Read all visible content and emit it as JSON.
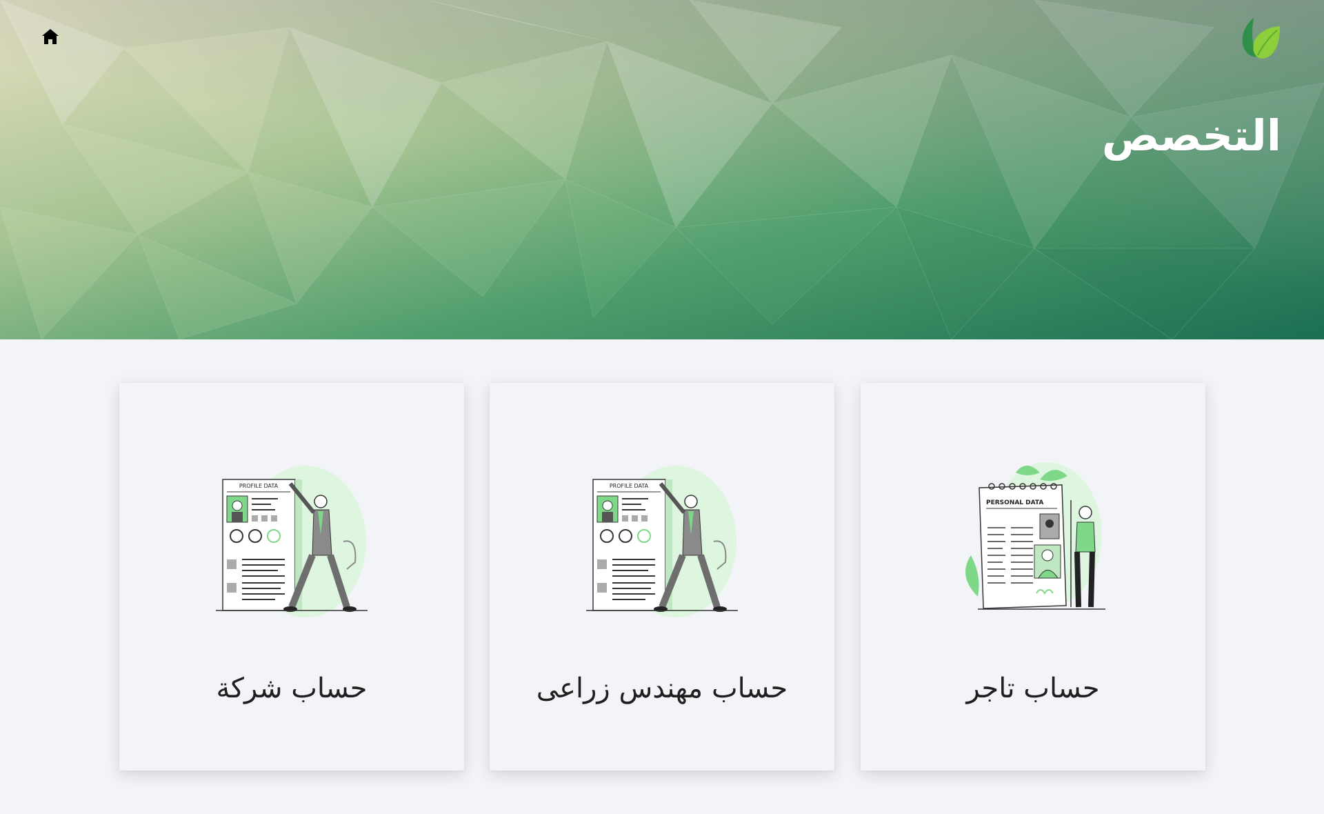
{
  "header": {
    "title": "التخصص",
    "home_icon": "home-icon",
    "logo_icon": "leaf-logo-icon",
    "gradient": [
      "#e6dfc3",
      "#9cbf8f",
      "#3f9a66",
      "#1a6e52"
    ]
  },
  "cards": [
    {
      "label": "حساب شركة",
      "illustration": "profile-data-illustration",
      "illustration_text": "PROFILE DATA"
    },
    {
      "label": "حساب مهندس زراعى",
      "illustration": "profile-data-illustration",
      "illustration_text": "PROFILE DATA"
    },
    {
      "label": "حساب تاجر",
      "illustration": "personal-data-illustration",
      "illustration_text": "PERSONAL DATA"
    }
  ],
  "colors": {
    "accent_green": "#7fd88a",
    "page_bg": "#f3f4f7"
  }
}
